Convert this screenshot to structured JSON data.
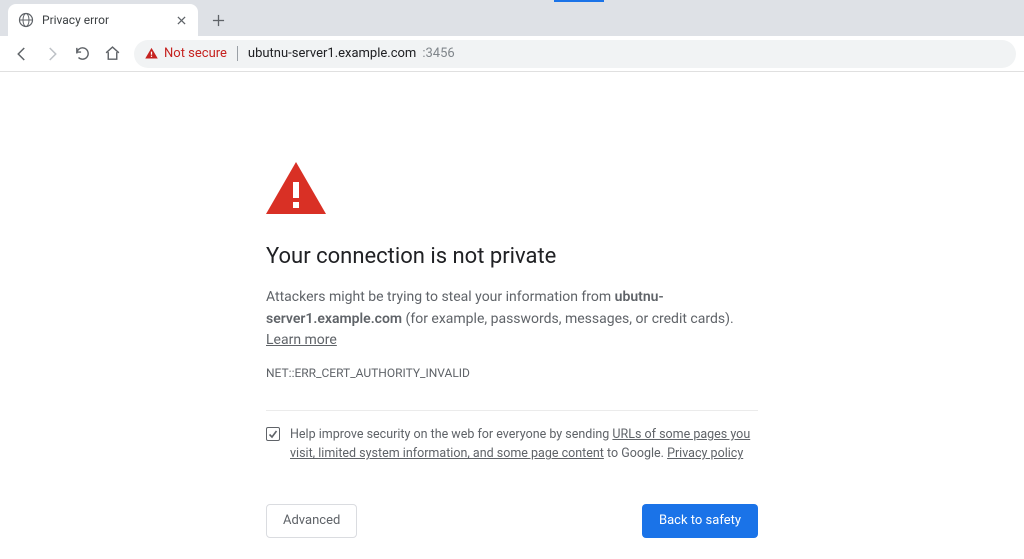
{
  "browser": {
    "tab_title": "Privacy error",
    "security_label": "Not secure",
    "url_host": "ubutnu-server1.example.com",
    "url_port": ":3456"
  },
  "page": {
    "heading": "Your connection is not private",
    "desc_prefix": "Attackers might be trying to steal your information from ",
    "desc_host": "ubutnu-server1.example.com",
    "desc_suffix": " (for example, passwords, messages, or credit cards). ",
    "learn_more": "Learn more",
    "error_code": "NET::ERR_CERT_AUTHORITY_INVALID",
    "opt_prefix": "Help improve security on the web for everyone by sending ",
    "opt_link1": "URLs of some pages you visit, limited system information, and some page content",
    "opt_mid": " to Google. ",
    "opt_link2": "Privacy policy",
    "btn_advanced": "Advanced",
    "btn_back": "Back to safety"
  }
}
